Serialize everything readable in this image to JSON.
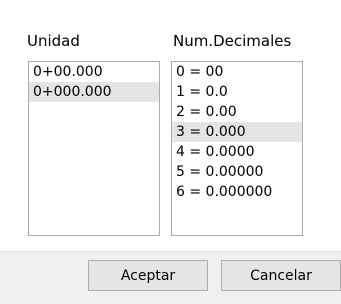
{
  "unidad": {
    "label": "Unidad",
    "options": [
      "0+00.000",
      "0+000.000"
    ],
    "selected_index": 1
  },
  "decimales": {
    "label": "Num.Decimales",
    "options": [
      "0 = 00",
      "1 = 0.0",
      "2 = 0.00",
      "3 = 0.000",
      "4 = 0.0000",
      "5 = 0.00000",
      "6 = 0.000000"
    ],
    "selected_index": 3
  },
  "buttons": {
    "accept_label": "Aceptar",
    "cancel_label": "Cancelar"
  },
  "colors": {
    "selection": "#e4e4e4",
    "footer": "#f0f0f0",
    "border": "#ababab"
  }
}
